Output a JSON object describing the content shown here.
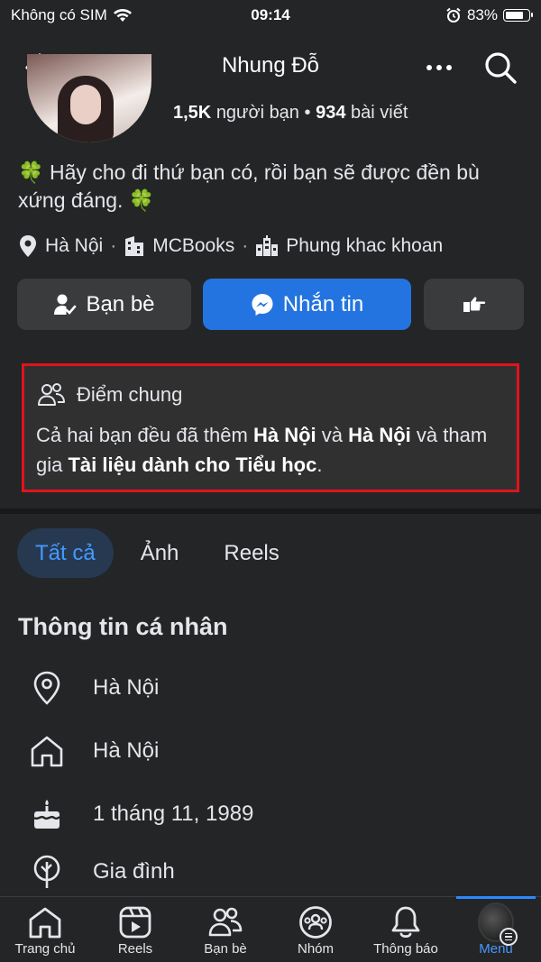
{
  "status_bar": {
    "carrier": "Không có SIM",
    "time": "09:14",
    "battery_percent": "83%",
    "battery_level": 0.83
  },
  "nav": {
    "title": "Nhung Đỗ"
  },
  "stats": {
    "friends_count": "1,5K",
    "friends_label": "người bạn",
    "dot": "•",
    "posts_count": "934",
    "posts_label": "bài viết"
  },
  "bio": {
    "emoji": "🍀",
    "text": "Hãy cho đi thứ bạn có, rồi bạn sẽ được đền bù xứng đáng."
  },
  "details": [
    {
      "icon": "location-pin-icon",
      "label": "Hà Nội"
    },
    {
      "icon": "building-icon",
      "label": "MCBooks"
    },
    {
      "icon": "office-building-icon",
      "label": "Phung khac khoan"
    }
  ],
  "details_separator": "·",
  "actions": {
    "friends_label": "Bạn bè",
    "message_label": "Nhắn tin"
  },
  "common": {
    "title": "Điểm chung",
    "t1": "Cả hai bạn đều đã thêm ",
    "b1": "Hà Nội",
    "t2": " và ",
    "b2": "Hà Nội",
    "t3": " và tham gia ",
    "b3": "Tài liệu dành cho Tiểu học",
    "t4": "."
  },
  "tabs": [
    {
      "label": "Tất cả",
      "active": true
    },
    {
      "label": "Ảnh"
    },
    {
      "label": "Reels"
    }
  ],
  "section_title": "Thông tin cá nhân",
  "info": [
    {
      "icon": "location-pin-icon",
      "label": "Hà Nội"
    },
    {
      "icon": "home-icon",
      "label": "Hà Nội"
    },
    {
      "icon": "birthday-cake-icon",
      "label": "1 tháng 11, 1989"
    },
    {
      "icon": "family-icon",
      "label": "Gia đình"
    }
  ],
  "tabbar": [
    {
      "label": "Trang chủ",
      "icon": "home-icon"
    },
    {
      "label": "Reels",
      "icon": "reels-icon"
    },
    {
      "label": "Bạn bè",
      "icon": "friends-icon"
    },
    {
      "label": "Nhóm",
      "icon": "groups-icon"
    },
    {
      "label": "Thông báo",
      "icon": "bell-icon"
    },
    {
      "label": "Menu",
      "icon": "menu-avatar",
      "active": true
    }
  ],
  "colors": {
    "background": "#242526",
    "accent": "#2374e1",
    "highlight_border": "#e0131c",
    "active_tab": "#4599ff"
  }
}
